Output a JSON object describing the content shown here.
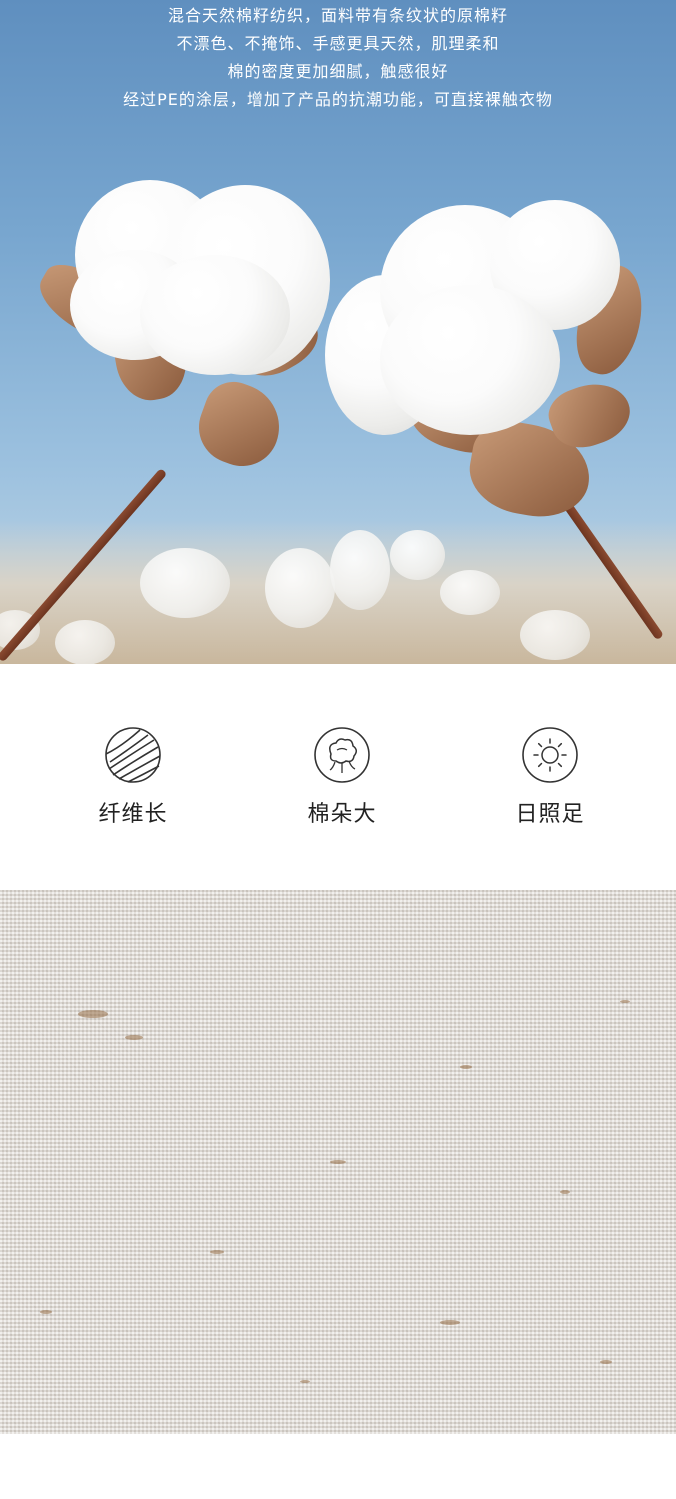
{
  "hero": {
    "lines": [
      "混合天然棉籽纺织，面料带有条纹状的原棉籽",
      "不漂色、不掩饰、手感更具天然，肌理柔和",
      "棉的密度更加细腻，触感很好",
      "经过PE的涂层，增加了产品的抗潮功能，可直接裸触衣物"
    ]
  },
  "features": [
    {
      "label": "纤维长",
      "icon": "yarn-ball-icon"
    },
    {
      "label": "棉朵大",
      "icon": "cotton-flower-icon"
    },
    {
      "label": "日照足",
      "icon": "sun-icon"
    }
  ],
  "colors": {
    "sky": "#78a6cf",
    "cotton": "#ffffff",
    "stem": "#7a3d25",
    "fabric": "#e2dfda",
    "label": "#222222"
  }
}
